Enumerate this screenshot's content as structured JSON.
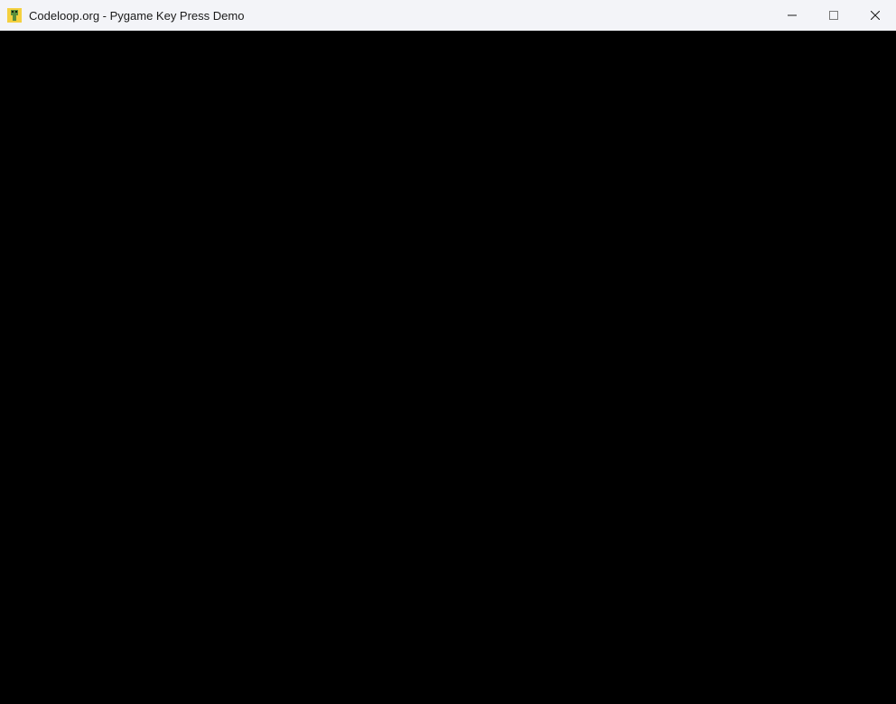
{
  "window": {
    "title": "Codeloop.org - Pygame Key Press Demo",
    "icon_name": "pygame-snake-icon",
    "controls": {
      "minimize_label": "Minimize",
      "maximize_label": "Maximize",
      "close_label": "Close"
    },
    "colors": {
      "titlebar_bg": "#f3f4f8",
      "client_bg": "#000000"
    }
  }
}
